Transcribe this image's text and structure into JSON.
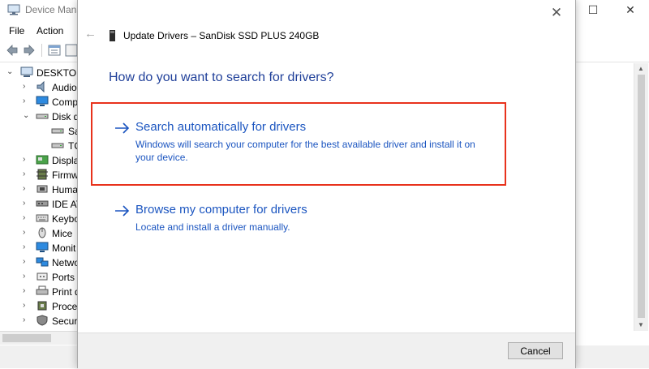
{
  "device_manager": {
    "title": "Device Mana",
    "caption_buttons": {
      "minimize": "—",
      "maximize": "☐",
      "close": "✕"
    },
    "menu": [
      "File",
      "Action"
    ],
    "toolbar_icons": [
      "back-icon",
      "forward-icon",
      "properties-icon",
      "help-icon",
      "display-icon"
    ],
    "tree": [
      {
        "label": "DESKTOP",
        "icon": "computer-icon",
        "chevron": "expanded"
      },
      {
        "label": "Audio",
        "icon": "speaker-icon",
        "chevron": "collapsed"
      },
      {
        "label": "Comp",
        "icon": "monitor-icon",
        "chevron": "collapsed"
      },
      {
        "label": "Disk d",
        "icon": "disk-drive-icon",
        "chevron": "expanded"
      },
      {
        "label": "Sa",
        "icon": "disk-drive-icon",
        "chevron": "none"
      },
      {
        "label": "TC",
        "icon": "disk-drive-icon",
        "chevron": "none"
      },
      {
        "label": "Displa",
        "icon": "display-adapter-icon",
        "chevron": "collapsed"
      },
      {
        "label": "Firmw",
        "icon": "firmware-icon",
        "chevron": "collapsed"
      },
      {
        "label": "Huma",
        "icon": "hid-icon",
        "chevron": "collapsed"
      },
      {
        "label": "IDE AT",
        "icon": "ide-controller-icon",
        "chevron": "collapsed"
      },
      {
        "label": "Keybo",
        "icon": "keyboard-icon",
        "chevron": "collapsed"
      },
      {
        "label": "Mice",
        "icon": "mouse-icon",
        "chevron": "collapsed"
      },
      {
        "label": "Monit",
        "icon": "monitor-icon",
        "chevron": "collapsed"
      },
      {
        "label": "Netwo",
        "icon": "network-icon",
        "chevron": "collapsed"
      },
      {
        "label": "Ports",
        "icon": "port-icon",
        "chevron": "collapsed"
      },
      {
        "label": "Print q",
        "icon": "printer-icon",
        "chevron": "collapsed"
      },
      {
        "label": "Proce",
        "icon": "processor-icon",
        "chevron": "collapsed"
      },
      {
        "label": "Secur",
        "icon": "security-icon",
        "chevron": "collapsed"
      }
    ]
  },
  "dialog": {
    "close_glyph": "✕",
    "back_glyph": "←",
    "title": "Update Drivers – SanDisk SSD PLUS 240GB",
    "heading": "How do you want to search for drivers?",
    "options": [
      {
        "title": "Search automatically for drivers",
        "description": "Windows will search your computer for the best available driver and install it on your device.",
        "highlighted": true
      },
      {
        "title": "Browse my computer for drivers",
        "description": "Locate and install a driver manually.",
        "highlighted": false
      }
    ],
    "cancel_label": "Cancel"
  },
  "colors": {
    "link_blue": "#1b55c0",
    "heading_blue": "#1f3f99",
    "highlight_red": "#e8321c"
  }
}
